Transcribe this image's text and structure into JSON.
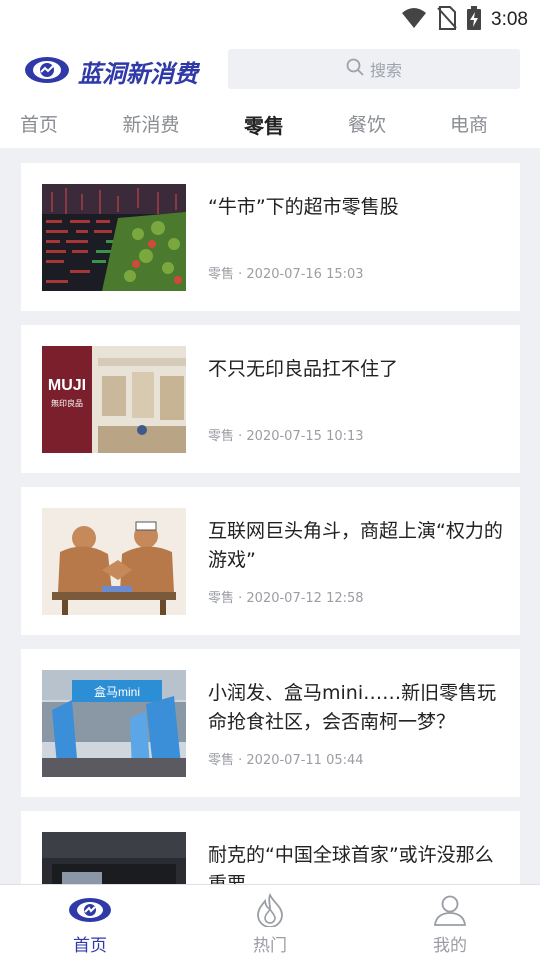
{
  "status_bar": {
    "time": "3:08"
  },
  "header": {
    "logo_text": "蓝洞新消费",
    "search_placeholder": "搜索"
  },
  "tabs": [
    {
      "label": "首页",
      "active": false
    },
    {
      "label": "新消费",
      "active": false
    },
    {
      "label": "零售",
      "active": true
    },
    {
      "label": "餐饮",
      "active": false
    },
    {
      "label": "电商",
      "active": false
    }
  ],
  "articles": [
    {
      "title": "“牛市”下的超市零售股",
      "meta": "零售 · 2020-07-16 15:03",
      "thumb": "stock-market-image"
    },
    {
      "title": "不只无印良品扛不住了",
      "meta": "零售 · 2020-07-15 10:13",
      "thumb": "muji-store-image",
      "thumb_text": "MUJI",
      "thumb_subtext": "無印良品"
    },
    {
      "title": "互联网巨头角斗，商超上演“权力的游戏”",
      "meta": "零售 · 2020-07-12 12:58",
      "thumb": "arm-wrestling-image"
    },
    {
      "title": "小润发、盒马mini……新旧零售玩命抢食社区，会否南柯一梦？",
      "meta": "零售 · 2020-07-11 05:44",
      "thumb": "hema-mini-store-image",
      "thumb_text": "盒马mini"
    },
    {
      "title": "耐克的“中国全球首家”或许没那么重要",
      "meta": "",
      "thumb": "nike-store-image"
    }
  ],
  "bottom_nav": [
    {
      "label": "首页",
      "icon": "home-logo-icon",
      "active": true
    },
    {
      "label": "热门",
      "icon": "flame-icon",
      "active": false
    },
    {
      "label": "我的",
      "icon": "user-icon",
      "active": false
    }
  ],
  "colors": {
    "brand": "#2f3aa8",
    "background": "#eef0f4"
  }
}
